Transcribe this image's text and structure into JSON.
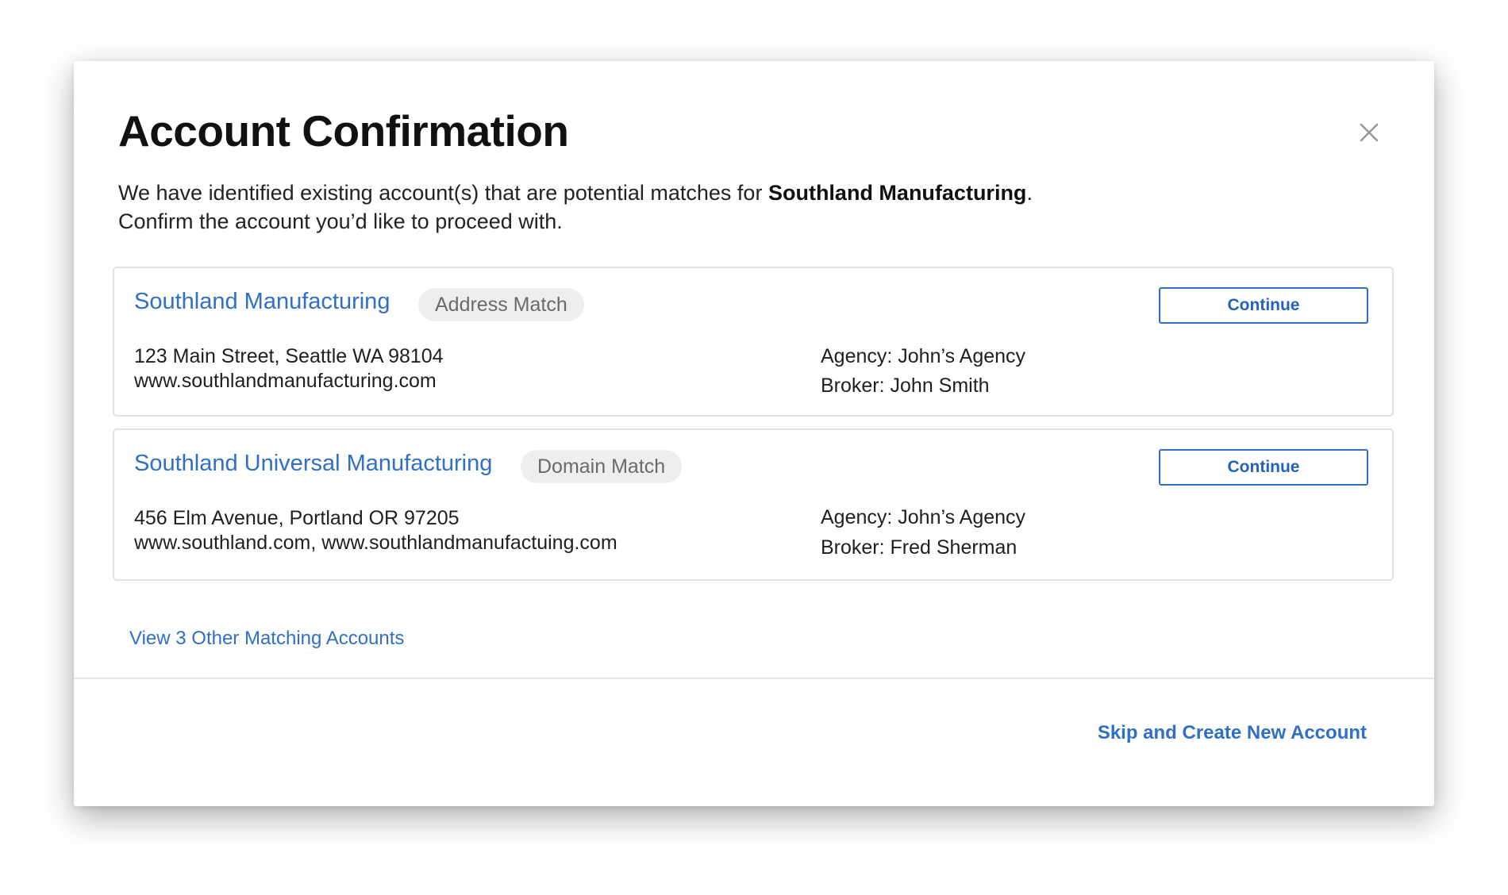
{
  "modal": {
    "title": "Account Confirmation",
    "close_icon": "close-icon",
    "intro": {
      "prefix": "We have identified existing account(s) that are potential matches for ",
      "company": "Southland Manufacturing",
      "suffix": ".",
      "line2": "Confirm the account you’d like to proceed with."
    },
    "accounts": [
      {
        "name": "Southland Manufacturing",
        "badge": "Address Match",
        "address": "123 Main Street, Seattle WA 98104",
        "websites": "www.southlandmanufacturing.com",
        "agency": "Agency: John’s Agency",
        "broker": "Broker: John Smith",
        "button_label": "Continue"
      },
      {
        "name": "Southland Universal Manufacturing",
        "badge": "Domain Match",
        "address": "456 Elm Avenue, Portland OR 97205",
        "websites": "www.southland.com, www.southlandmanufactuing.com",
        "agency": "Agency: John’s Agency",
        "broker": "Broker: Fred Sherman",
        "button_label": "Continue"
      }
    ],
    "other_matches_link": "View 3 Other Matching Accounts",
    "skip_link": "Skip and Create New Account"
  },
  "colors": {
    "accent": "#2f6fc6",
    "badge_bg": "#eeeeee",
    "border": "#e2e2e2"
  }
}
